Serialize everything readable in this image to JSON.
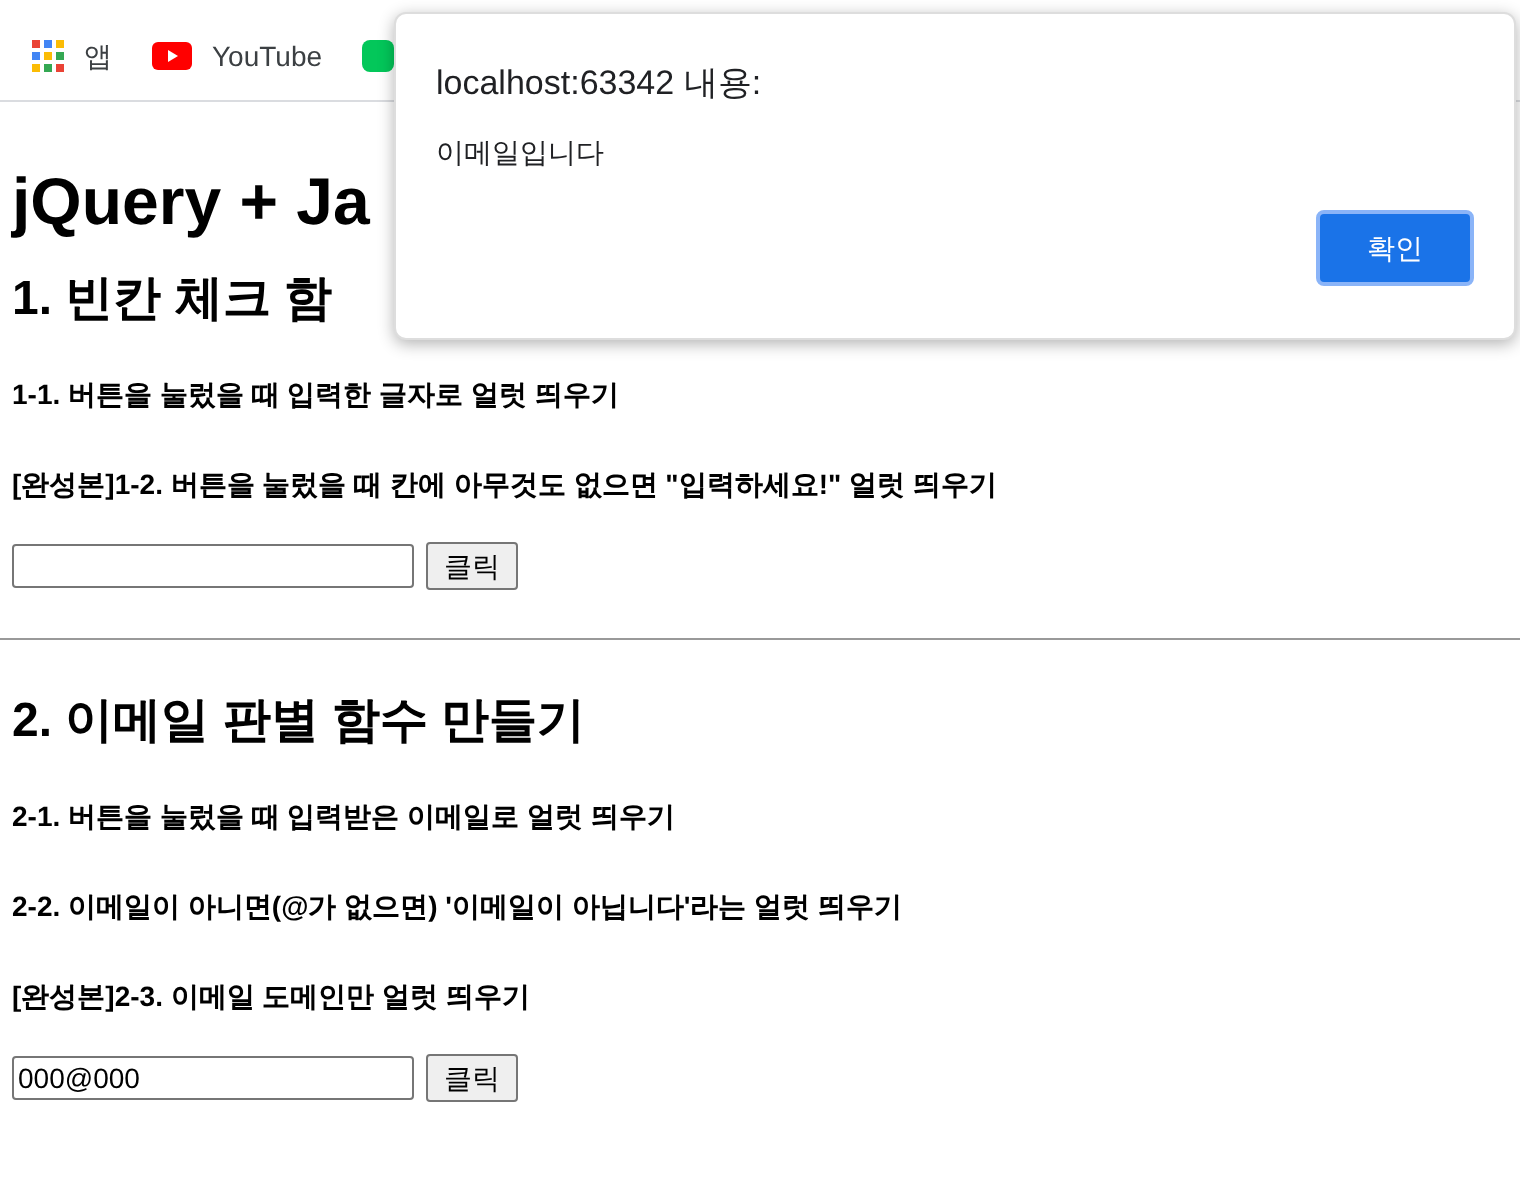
{
  "bookmarks": [
    {
      "kind": "apps",
      "label": "앱"
    },
    {
      "kind": "youtube",
      "label": "YouTube"
    },
    {
      "kind": "green"
    }
  ],
  "page": {
    "title": "jQuery + Ja",
    "sections": [
      {
        "heading": "1. 빈칸 체크 함",
        "tasks": [
          "**1-1.** 버튼을 눌렀을 때 입력한 글자로 얼럿 띄우기",
          "[완성본]**1-2.** 버튼을 눌렀을 때 칸에 아무것도 없으면 \"입력하세요!\" 얼럿 띄우기"
        ],
        "button": "클릭"
      },
      {
        "heading": "2. 이메일 판별 함수 만들기",
        "tasks": [
          "**2-1.** 버튼을 눌렀을 때 입력받은 이메일로 얼럿 띄우기",
          "**2-2.** 이메일이 아니면(@가 없으면) '이메일이 아닙니다'라는 얼럿 띄우기",
          "[완성본]**2-3.** 이메일 도메인만 얼럿 띄우기"
        ],
        "input_value": "000@000",
        "button": "클릭"
      }
    ]
  },
  "dialog": {
    "title": "localhost:63342 내용:",
    "message": "이메일입니다",
    "button": "확인"
  }
}
